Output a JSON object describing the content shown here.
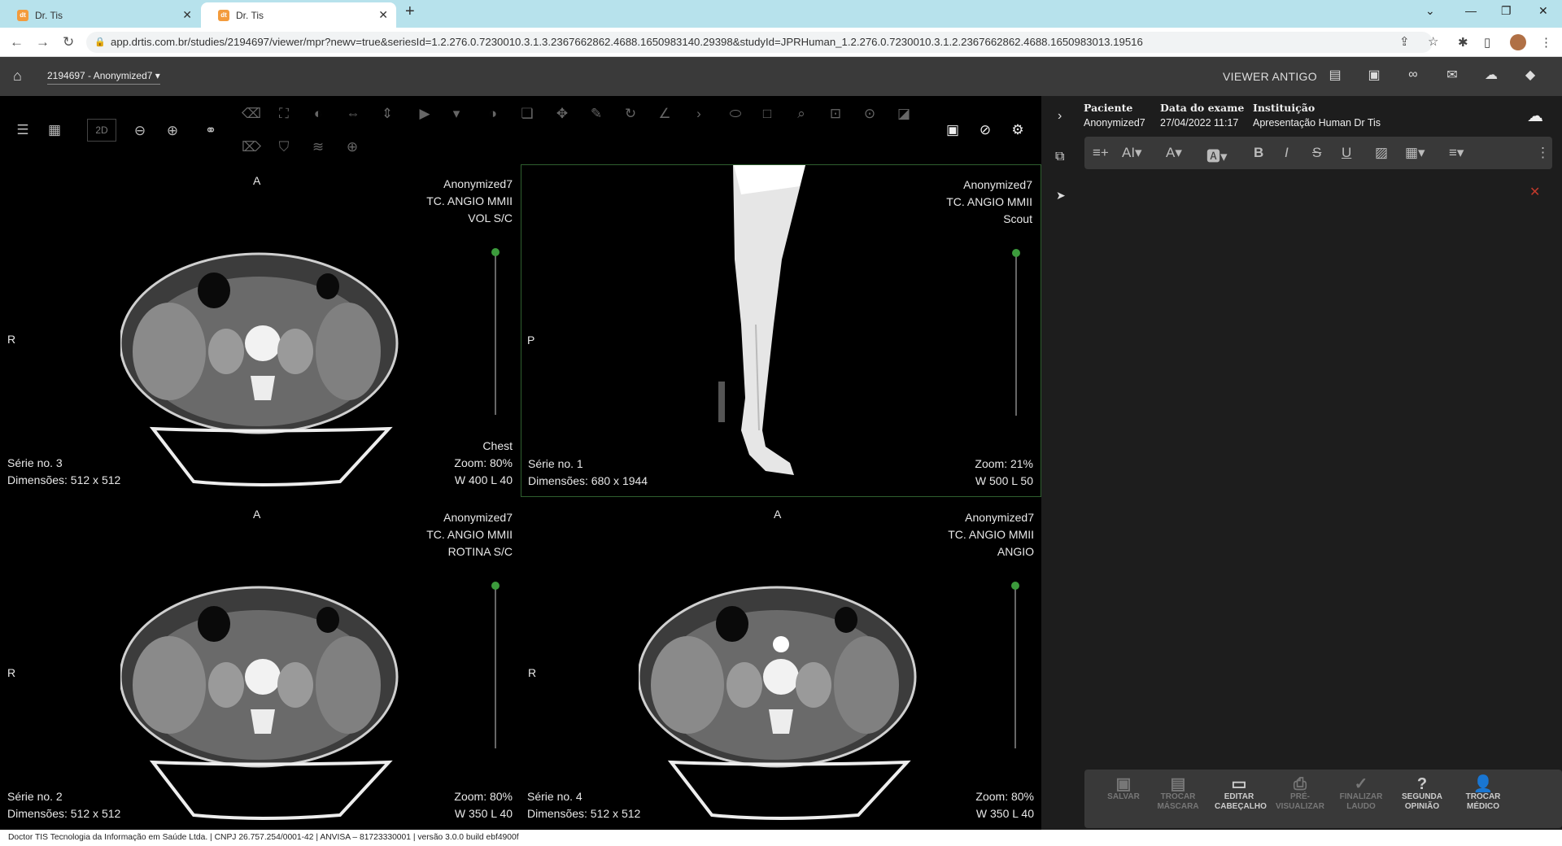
{
  "browser": {
    "tabs": [
      {
        "title": "Dr. Tis",
        "favicon": "dr-tis-favicon"
      },
      {
        "title": "Dr. Tis",
        "favicon": "dr-tis-favicon"
      }
    ],
    "url": "app.drtis.com.br/studies/2194697/viewer/mpr?newv=true&seriesId=1.2.276.0.7230010.3.1.3.2367662862.4688.1650983140.29398&studyId=JPRHuman_1.2.276.0.7230010.3.1.2.2367662862.4688.1650983013.19516"
  },
  "appbar": {
    "study": "2194697 - Anonymized7",
    "viewer_antigo": "VIEWER ANTIGO"
  },
  "toolbar": {
    "mode": "2D"
  },
  "viewports": [
    {
      "top": "A",
      "left": "R",
      "tr": [
        "Anonymized7",
        "TC. ANGIO MMII",
        "VOL S/C"
      ],
      "bl": [
        "Série no. 3",
        "Dimensões: 512 x 512"
      ],
      "br": [
        "Chest",
        "Zoom: 80%",
        "W 400 L 40"
      ]
    },
    {
      "top": "",
      "left": "P",
      "tr": [
        "Anonymized7",
        "TC. ANGIO MMII",
        "Scout"
      ],
      "bl": [
        "Série no. 1",
        "Dimensões: 680 x 1944"
      ],
      "br": [
        "",
        "Zoom: 21%",
        "W 500 L 50"
      ]
    },
    {
      "top": "A",
      "left": "R",
      "tr": [
        "Anonymized7",
        "TC. ANGIO MMII",
        "ROTINA S/C"
      ],
      "bl": [
        "Série no. 2",
        "Dimensões: 512 x 512"
      ],
      "br": [
        "",
        "Zoom: 80%",
        "W 350 L 40"
      ]
    },
    {
      "top": "A",
      "left": "R",
      "tr": [
        "Anonymized7",
        "TC. ANGIO MMII",
        "ANGIO"
      ],
      "bl": [
        "Série no. 4",
        "Dimensões: 512 x 512"
      ],
      "br": [
        "",
        "Zoom: 80%",
        "W 350 L 40"
      ]
    }
  ],
  "panel": {
    "h_paciente": "Paciente",
    "v_paciente": "Anonymized7",
    "h_data": "Data do exame",
    "v_data": "27/04/2022 11:17",
    "h_inst": "Instituição",
    "v_inst": "Apresentação Human Dr Tis"
  },
  "report_buttons": [
    {
      "l1": "SALVAR",
      "l2": ""
    },
    {
      "l1": "TROCAR",
      "l2": "MÁSCARA"
    },
    {
      "l1": "EDITAR",
      "l2": "CABEÇALHO"
    },
    {
      "l1": "PRÉ-",
      "l2": "VISUALIZAR"
    },
    {
      "l1": "FINALIZAR",
      "l2": "LAUDO"
    },
    {
      "l1": "SEGUNDA",
      "l2": "OPINIÃO"
    },
    {
      "l1": "TROCAR",
      "l2": "MÉDICO"
    }
  ],
  "footer": "Doctor TIS Tecnologia da Informação em Saúde Ltda. | CNPJ 26.757.254/0001-42 | ANVISA – 81723330001 | versão 3.0.0 build ebf4900f"
}
